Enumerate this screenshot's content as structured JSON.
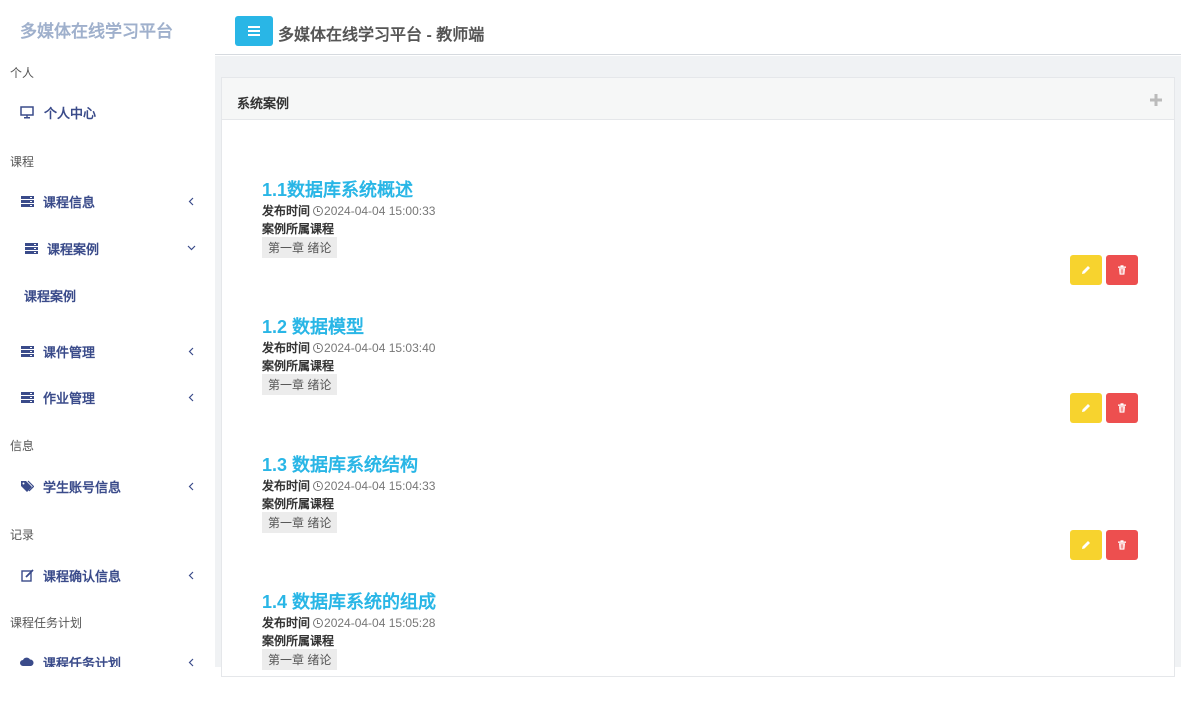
{
  "app": {
    "brand": "多媒体在线学习平台",
    "header_title": "多媒体在线学习平台 - 教师端"
  },
  "sidebar": {
    "sections": [
      {
        "label": "个人"
      },
      {
        "label": "课程"
      },
      {
        "label": "信息"
      },
      {
        "label": "记录"
      },
      {
        "label": "课程任务计划"
      }
    ],
    "items": [
      {
        "label": "个人中心",
        "icon": "monitor-icon"
      },
      {
        "label": "课程信息",
        "icon": "server-icon"
      },
      {
        "label": "课程案例",
        "icon": "server-icon",
        "expanded": true
      },
      {
        "label": "课件管理",
        "icon": "server-icon"
      },
      {
        "label": "作业管理",
        "icon": "server-icon"
      },
      {
        "label": "学生账号信息",
        "icon": "tags-icon"
      },
      {
        "label": "课程确认信息",
        "icon": "edit-icon"
      },
      {
        "label": "课程任务计划",
        "icon": "cloud-icon"
      }
    ],
    "sub_items": [
      {
        "label": "课程案例"
      }
    ]
  },
  "panel": {
    "title": "系统案例"
  },
  "cases": [
    {
      "title": "1.1数据库系统概述",
      "time_label": "发布时间",
      "time": "2024-04-04 15:00:33",
      "course_label": "案例所属课程",
      "course": "第一章 绪论"
    },
    {
      "title": "1.2 数据模型",
      "time_label": "发布时间",
      "time": "2024-04-04 15:03:40",
      "course_label": "案例所属课程",
      "course": "第一章 绪论"
    },
    {
      "title": "1.3 数据库系统结构",
      "time_label": "发布时间",
      "time": "2024-04-04 15:04:33",
      "course_label": "案例所属课程",
      "course": "第一章 绪论"
    },
    {
      "title": "1.4 数据库系统的组成",
      "time_label": "发布时间",
      "time": "2024-04-04 15:05:28",
      "course_label": "案例所属课程",
      "course": "第一章 绪论"
    }
  ],
  "colors": {
    "accent": "#29b6e6",
    "edit": "#f7d32e",
    "delete": "#ed4f4f",
    "nav_text": "#3a4b8a",
    "brand": "#9fb0cc"
  }
}
